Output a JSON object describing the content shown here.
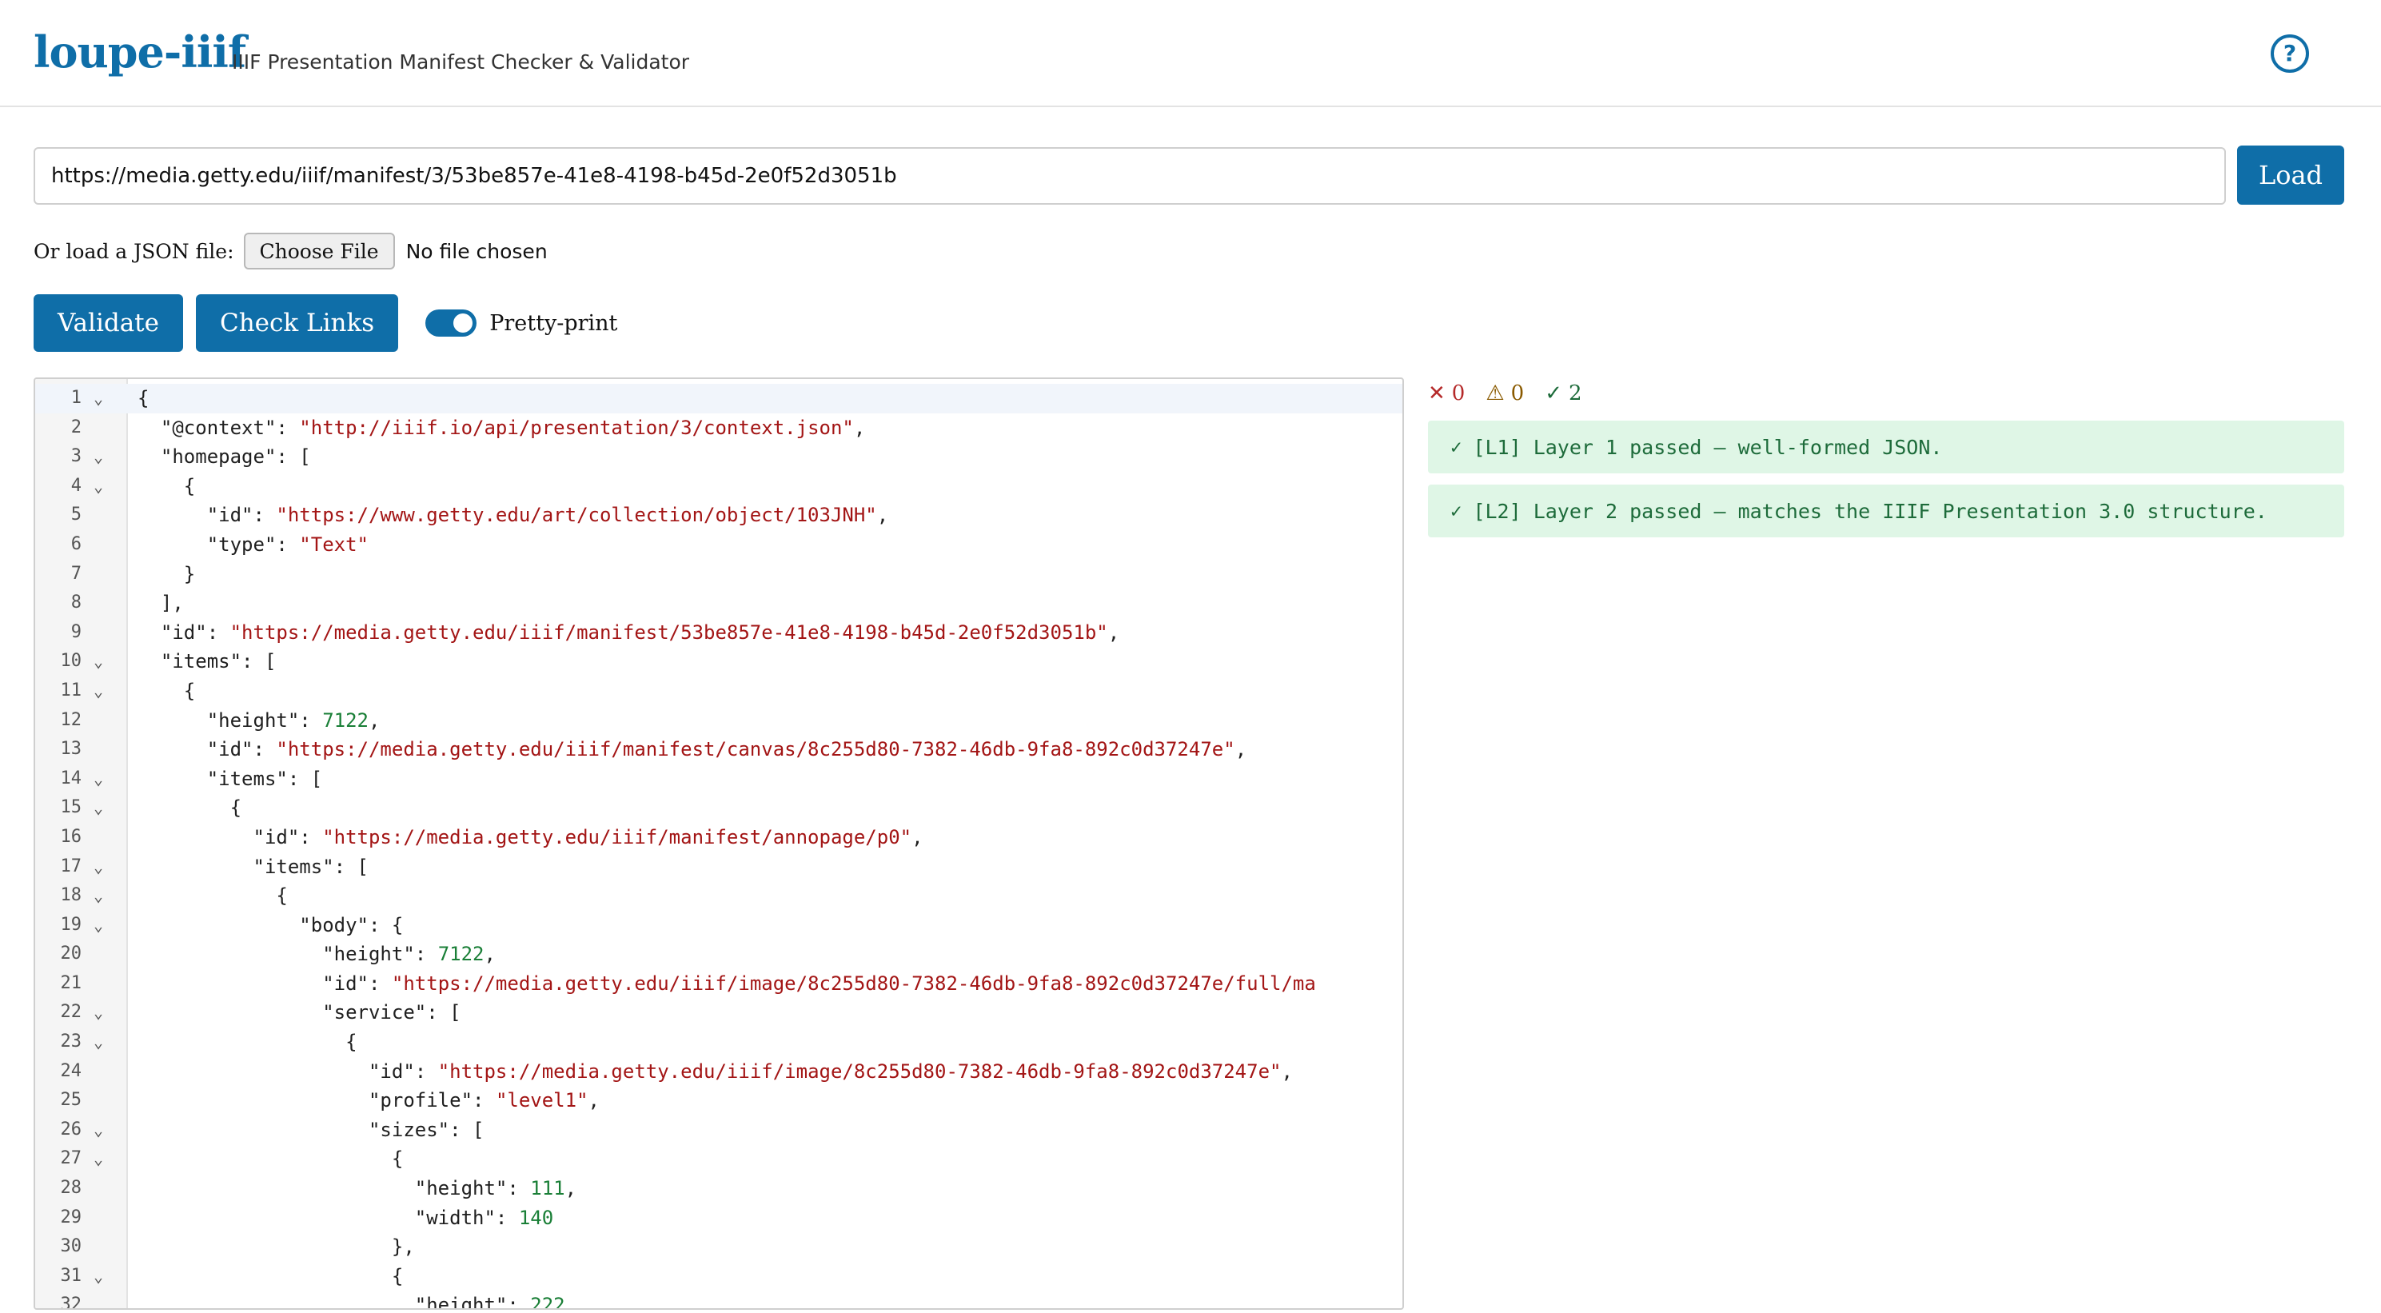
{
  "header": {
    "logo": "loupe-iiif",
    "tagline": "IIIF Presentation Manifest Checker & Validator",
    "help_icon": "?"
  },
  "url_form": {
    "url_value": "https://media.getty.edu/iiif/manifest/3/53be857e-41e8-4198-b45d-2e0f52d3051b",
    "load_label": "Load"
  },
  "file_form": {
    "label": "Or load a JSON file:",
    "choose_label": "Choose File",
    "status": "No file chosen"
  },
  "actions": {
    "validate_label": "Validate",
    "check_links_label": "Check Links",
    "pretty_print_label": "Pretty-print",
    "pretty_print_on": true
  },
  "editor": {
    "fold_icon": "⌄",
    "lines": [
      {
        "n": "1",
        "fold": true,
        "active": true,
        "parts": [
          {
            "t": "p",
            "v": "{"
          }
        ]
      },
      {
        "n": "2",
        "fold": false,
        "parts": [
          {
            "t": "p",
            "v": "  \"@context\": "
          },
          {
            "t": "s",
            "v": "\"http://iiif.io/api/presentation/3/context.json\""
          },
          {
            "t": "p",
            "v": ","
          }
        ]
      },
      {
        "n": "3",
        "fold": true,
        "parts": [
          {
            "t": "p",
            "v": "  \"homepage\": ["
          }
        ]
      },
      {
        "n": "4",
        "fold": true,
        "parts": [
          {
            "t": "p",
            "v": "    {"
          }
        ]
      },
      {
        "n": "5",
        "fold": false,
        "parts": [
          {
            "t": "p",
            "v": "      \"id\": "
          },
          {
            "t": "s",
            "v": "\"https://www.getty.edu/art/collection/object/103JNH\""
          },
          {
            "t": "p",
            "v": ","
          }
        ]
      },
      {
        "n": "6",
        "fold": false,
        "parts": [
          {
            "t": "p",
            "v": "      \"type\": "
          },
          {
            "t": "s",
            "v": "\"Text\""
          }
        ]
      },
      {
        "n": "7",
        "fold": false,
        "parts": [
          {
            "t": "p",
            "v": "    }"
          }
        ]
      },
      {
        "n": "8",
        "fold": false,
        "parts": [
          {
            "t": "p",
            "v": "  ],"
          }
        ]
      },
      {
        "n": "9",
        "fold": false,
        "parts": [
          {
            "t": "p",
            "v": "  \"id\": "
          },
          {
            "t": "s",
            "v": "\"https://media.getty.edu/iiif/manifest/53be857e-41e8-4198-b45d-2e0f52d3051b\""
          },
          {
            "t": "p",
            "v": ","
          }
        ]
      },
      {
        "n": "10",
        "fold": true,
        "parts": [
          {
            "t": "p",
            "v": "  \"items\": ["
          }
        ]
      },
      {
        "n": "11",
        "fold": true,
        "parts": [
          {
            "t": "p",
            "v": "    {"
          }
        ]
      },
      {
        "n": "12",
        "fold": false,
        "parts": [
          {
            "t": "p",
            "v": "      \"height\": "
          },
          {
            "t": "n",
            "v": "7122"
          },
          {
            "t": "p",
            "v": ","
          }
        ]
      },
      {
        "n": "13",
        "fold": false,
        "parts": [
          {
            "t": "p",
            "v": "      \"id\": "
          },
          {
            "t": "s",
            "v": "\"https://media.getty.edu/iiif/manifest/canvas/8c255d80-7382-46db-9fa8-892c0d37247e\""
          },
          {
            "t": "p",
            "v": ","
          }
        ]
      },
      {
        "n": "14",
        "fold": true,
        "parts": [
          {
            "t": "p",
            "v": "      \"items\": ["
          }
        ]
      },
      {
        "n": "15",
        "fold": true,
        "parts": [
          {
            "t": "p",
            "v": "        {"
          }
        ]
      },
      {
        "n": "16",
        "fold": false,
        "parts": [
          {
            "t": "p",
            "v": "          \"id\": "
          },
          {
            "t": "s",
            "v": "\"https://media.getty.edu/iiif/manifest/annopage/p0\""
          },
          {
            "t": "p",
            "v": ","
          }
        ]
      },
      {
        "n": "17",
        "fold": true,
        "parts": [
          {
            "t": "p",
            "v": "          \"items\": ["
          }
        ]
      },
      {
        "n": "18",
        "fold": true,
        "parts": [
          {
            "t": "p",
            "v": "            {"
          }
        ]
      },
      {
        "n": "19",
        "fold": true,
        "parts": [
          {
            "t": "p",
            "v": "              \"body\": {"
          }
        ]
      },
      {
        "n": "20",
        "fold": false,
        "parts": [
          {
            "t": "p",
            "v": "                \"height\": "
          },
          {
            "t": "n",
            "v": "7122"
          },
          {
            "t": "p",
            "v": ","
          }
        ]
      },
      {
        "n": "21",
        "fold": false,
        "parts": [
          {
            "t": "p",
            "v": "                \"id\": "
          },
          {
            "t": "s",
            "v": "\"https://media.getty.edu/iiif/image/8c255d80-7382-46db-9fa8-892c0d37247e/full/ma"
          }
        ]
      },
      {
        "n": "22",
        "fold": true,
        "parts": [
          {
            "t": "p",
            "v": "                \"service\": ["
          }
        ]
      },
      {
        "n": "23",
        "fold": true,
        "parts": [
          {
            "t": "p",
            "v": "                  {"
          }
        ]
      },
      {
        "n": "24",
        "fold": false,
        "parts": [
          {
            "t": "p",
            "v": "                    \"id\": "
          },
          {
            "t": "s",
            "v": "\"https://media.getty.edu/iiif/image/8c255d80-7382-46db-9fa8-892c0d37247e\""
          },
          {
            "t": "p",
            "v": ","
          }
        ]
      },
      {
        "n": "25",
        "fold": false,
        "parts": [
          {
            "t": "p",
            "v": "                    \"profile\": "
          },
          {
            "t": "s",
            "v": "\"level1\""
          },
          {
            "t": "p",
            "v": ","
          }
        ]
      },
      {
        "n": "26",
        "fold": true,
        "parts": [
          {
            "t": "p",
            "v": "                    \"sizes\": ["
          }
        ]
      },
      {
        "n": "27",
        "fold": true,
        "parts": [
          {
            "t": "p",
            "v": "                      {"
          }
        ]
      },
      {
        "n": "28",
        "fold": false,
        "parts": [
          {
            "t": "p",
            "v": "                        \"height\": "
          },
          {
            "t": "n",
            "v": "111"
          },
          {
            "t": "p",
            "v": ","
          }
        ]
      },
      {
        "n": "29",
        "fold": false,
        "parts": [
          {
            "t": "p",
            "v": "                        \"width\": "
          },
          {
            "t": "n",
            "v": "140"
          }
        ]
      },
      {
        "n": "30",
        "fold": false,
        "parts": [
          {
            "t": "p",
            "v": "                      },"
          }
        ]
      },
      {
        "n": "31",
        "fold": true,
        "parts": [
          {
            "t": "p",
            "v": "                      {"
          }
        ]
      },
      {
        "n": "32",
        "fold": false,
        "parts": [
          {
            "t": "p",
            "v": "                        \"height\": "
          },
          {
            "t": "n",
            "v": "222"
          },
          {
            "t": "p",
            "v": ","
          }
        ]
      }
    ]
  },
  "results": {
    "error_count": "0",
    "warning_count": "0",
    "passed_count": "2",
    "error_icon": "✕",
    "warning_icon": "⚠",
    "passed_icon": "✓",
    "messages": [
      {
        "icon": "✓",
        "text": "[L1] Layer 1 passed – well-formed JSON."
      },
      {
        "icon": "✓",
        "text": "[L2] Layer 2 passed – matches the IIIF Presentation 3.0 structure."
      }
    ]
  },
  "colors": {
    "accent": "#0f6ea8",
    "string": "#a31515",
    "number": "#1a7f37",
    "success_bg": "#dff6e6",
    "success_text": "#1d6b3a",
    "error": "#b52a2a",
    "warning": "#8a5a00"
  }
}
